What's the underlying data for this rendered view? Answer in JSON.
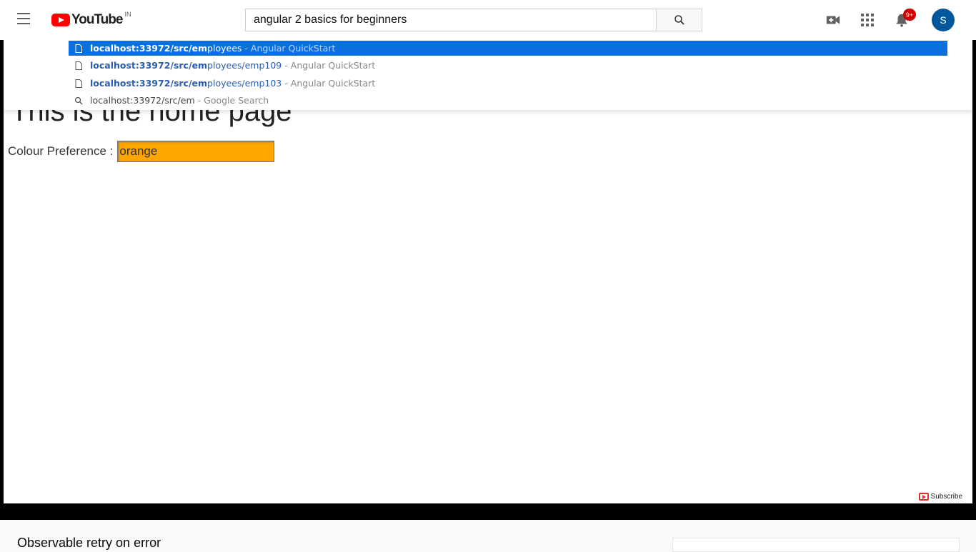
{
  "masthead": {
    "logo_text": "YouTube",
    "country_code": "IN",
    "search": {
      "value": "angular 2 basics for beginners",
      "placeholder": "Search"
    },
    "notification_count": "9+",
    "avatar_initial": "S"
  },
  "video": {
    "page_heading": "This is the home page",
    "colour_label": "Colour Preference :",
    "colour_value": "orange",
    "watermark_label": "Subscribe",
    "autocomplete": [
      {
        "host": "localhost:33972/src/em",
        "rest": "ployees",
        "sep": "-",
        "desc": "Angular QuickStart",
        "icon": "page-icon",
        "selected": true
      },
      {
        "host": "localhost:33972/src/em",
        "rest": "ployees/emp109",
        "sep": "-",
        "desc": "Angular QuickStart",
        "icon": "page-icon",
        "selected": false
      },
      {
        "host": "localhost:33972/src/em",
        "rest": "ployees/emp103",
        "sep": "-",
        "desc": "Angular QuickStart",
        "icon": "page-icon",
        "selected": false
      },
      {
        "host": "localhost:33972/src/em",
        "rest": "",
        "sep": "-",
        "desc": "Google Search",
        "icon": "search-icon",
        "selected": false
      }
    ]
  },
  "below": {
    "video_title": "Observable retry on error"
  },
  "colors": {
    "brand_red": "#ff0000",
    "selection_blue": "#0c6fde",
    "orange_input": "#ffa500",
    "avatar_blue": "#00579b"
  }
}
